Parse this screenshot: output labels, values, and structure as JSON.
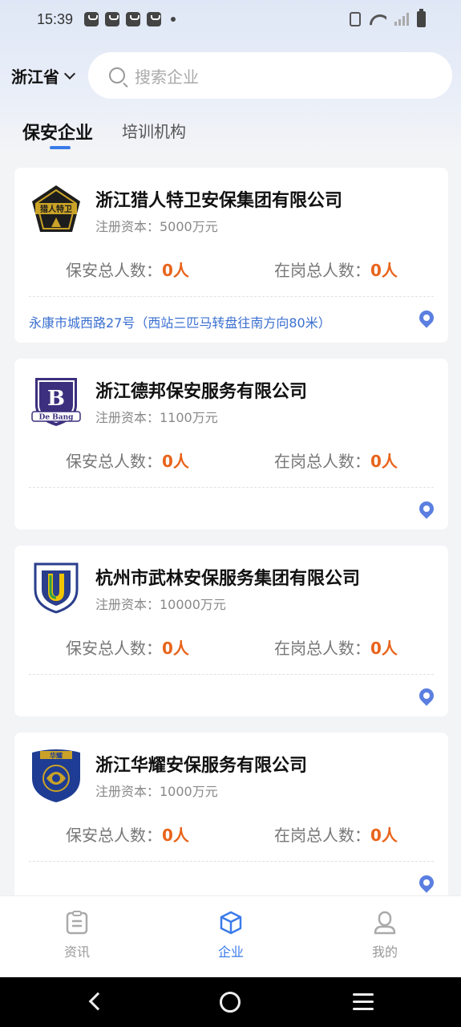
{
  "status": {
    "time": "15:39",
    "icons": [
      "notification-icon",
      "notification-icon",
      "notification-icon",
      "notification-icon",
      "more-dot-icon",
      "vibrate-icon",
      "wifi-icon",
      "signal-icon",
      "battery-icon"
    ]
  },
  "header": {
    "region": "浙江省",
    "search_placeholder": "搜索企业"
  },
  "tabs": [
    {
      "label": "保安企业",
      "active": true
    },
    {
      "label": "培训机构",
      "active": false
    }
  ],
  "companies": [
    {
      "name": "浙江猎人特卫安保集团有限公司",
      "capital": "注册资本：5000万元",
      "security_label": "保安总人数：",
      "security_value": "0人",
      "onduty_label": "在岗总人数：",
      "onduty_value": "0人",
      "address": "永康市城西路27号（西站三匹马转盘往南方向80米）"
    },
    {
      "name": "浙江德邦保安服务有限公司",
      "capital": "注册资本：1100万元",
      "security_label": "保安总人数：",
      "security_value": "0人",
      "onduty_label": "在岗总人数：",
      "onduty_value": "0人",
      "address": ""
    },
    {
      "name": "杭州市武林安保服务集团有限公司",
      "capital": "注册资本：10000万元",
      "security_label": "保安总人数：",
      "security_value": "0人",
      "onduty_label": "在岗总人数：",
      "onduty_value": "0人",
      "address": ""
    },
    {
      "name": "浙江华耀安保服务有限公司",
      "capital": "注册资本：1000万元",
      "security_label": "保安总人数：",
      "security_value": "0人",
      "onduty_label": "在岗总人数：",
      "onduty_value": "0人",
      "address": ""
    }
  ],
  "logos": {
    "card1_text": "猎人特卫",
    "card2_text": "De Bang",
    "card4_text": "华耀"
  },
  "bottom_nav": [
    {
      "label": "资讯",
      "icon": "news-icon",
      "active": false
    },
    {
      "label": "企业",
      "icon": "company-icon",
      "active": true
    },
    {
      "label": "我的",
      "icon": "profile-icon",
      "active": false
    }
  ],
  "colors": {
    "accent": "#3a7bea",
    "number": "#e8641b",
    "address": "#3a6fd0"
  }
}
